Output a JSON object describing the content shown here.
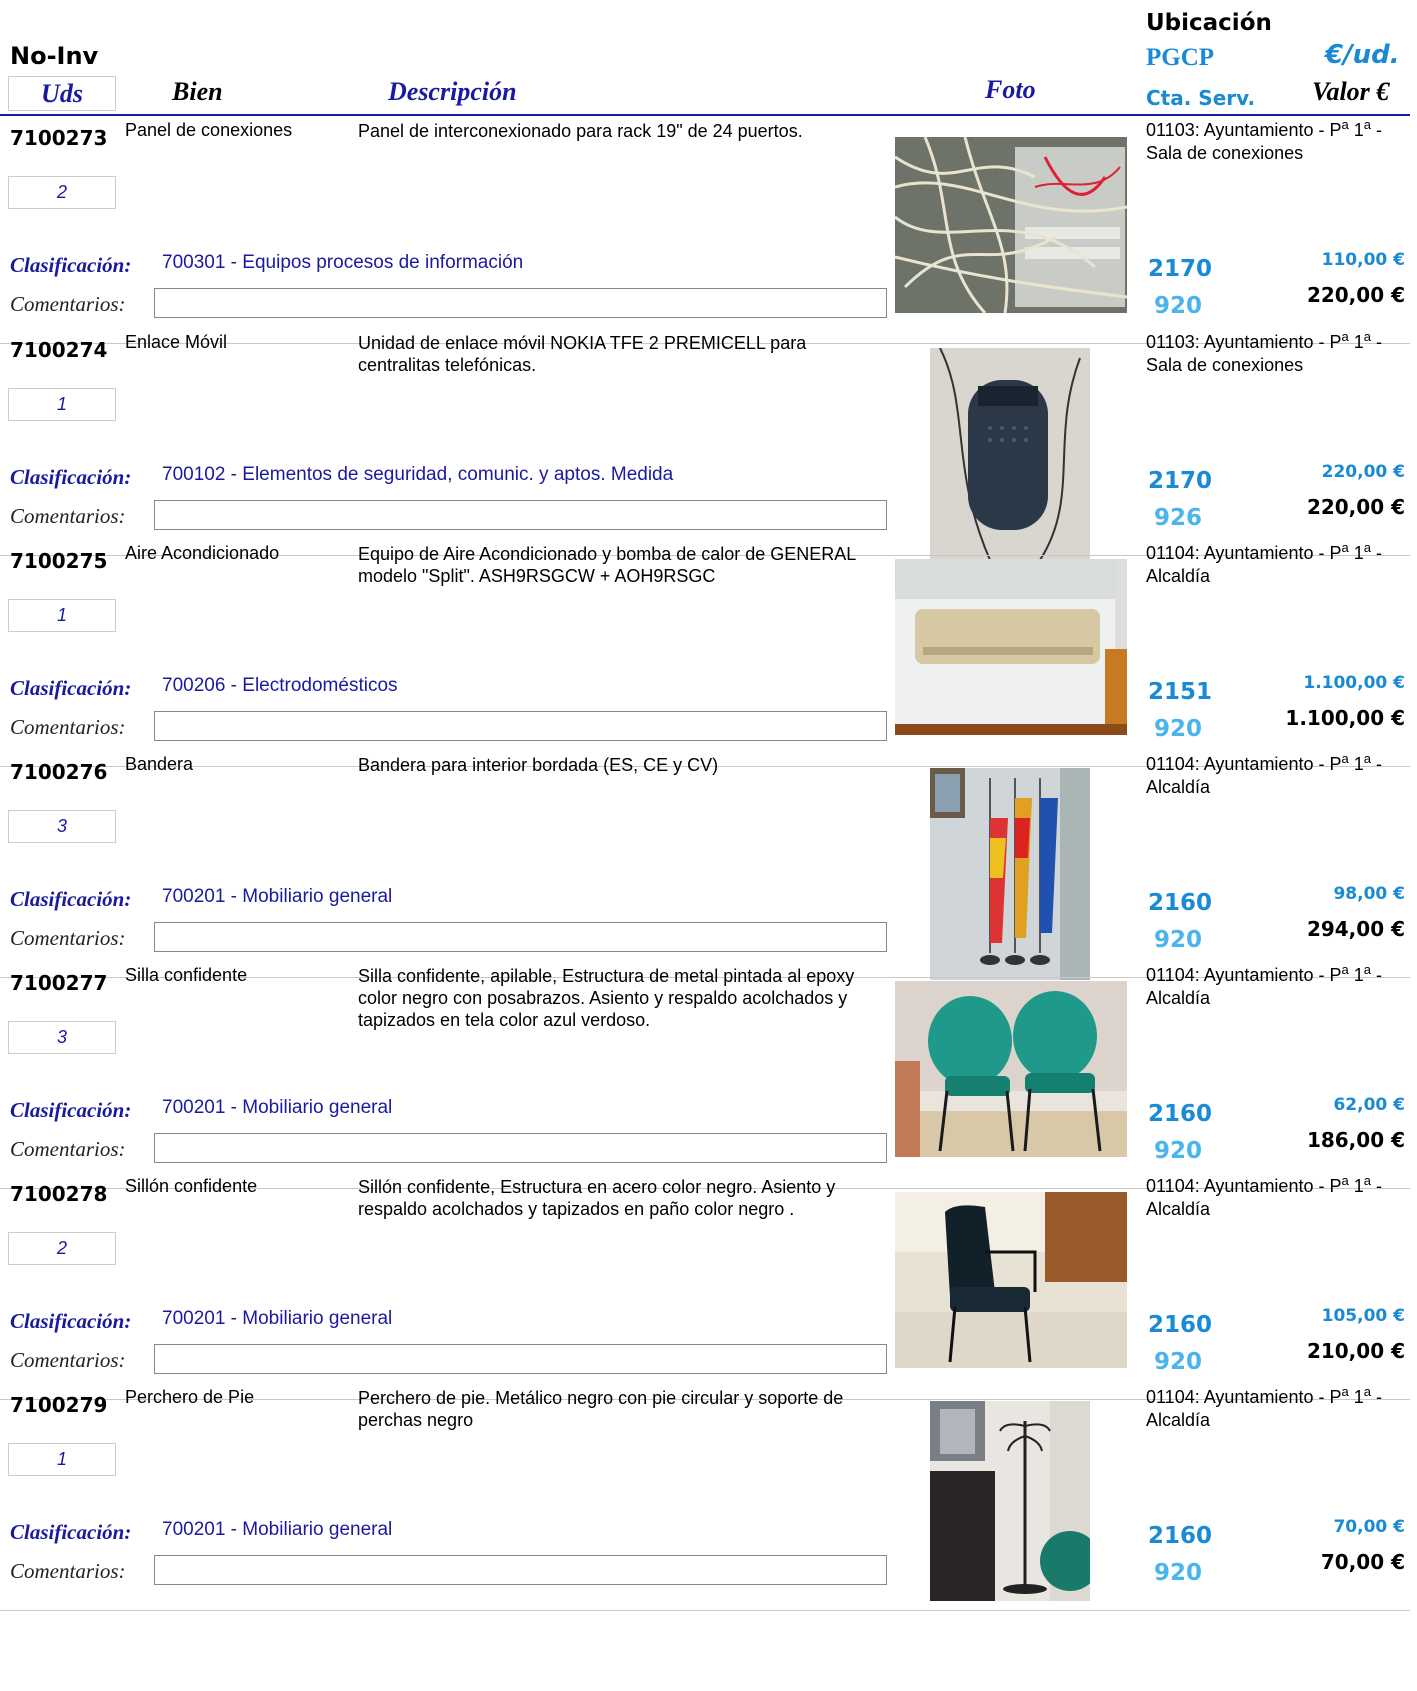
{
  "header": {
    "no_inv": "No-Inv",
    "uds": "Uds",
    "bien": "Bien",
    "descripcion": "Descripción",
    "foto": "Foto",
    "ubicacion": "Ubicación",
    "pgcp": "PGCP",
    "eur_ud": "€/ud.",
    "cta_serv": "Cta. Serv.",
    "valor": "Valor €"
  },
  "labels": {
    "clasificacion": "Clasificación:",
    "comentarios": "Comentarios:"
  },
  "records": [
    {
      "inv": "7100273",
      "qty": "2",
      "name": "Panel de conexiones",
      "description": "Panel de interconexionado para rack 19\" de 24 puertos.",
      "classification": "700301 - Equipos procesos de información",
      "location": "01103: Ayuntamiento - Pª 1ª - Sala de conexiones",
      "account": "2170",
      "service": "920",
      "unit_value": "110,00 €",
      "total_value": "220,00 €",
      "photo": "network patch panel with cables"
    },
    {
      "inv": "7100274",
      "qty": "1",
      "name": "Enlace Móvil",
      "description": "Unidad de enlace móvil NOKIA TFE 2 PREMICELL para centralitas telefónicas.",
      "classification": "700102 - Elementos de seguridad, comunic. y aptos. Medida",
      "location": "01103: Ayuntamiento - Pª 1ª - Sala de conexiones",
      "account": "2170",
      "service": "926",
      "unit_value": "220,00 €",
      "total_value": "220,00 €",
      "photo": "black wall-mounted mobile link unit"
    },
    {
      "inv": "7100275",
      "qty": "1",
      "name": "Aire Acondicionado",
      "description": "Equipo de Aire Acondicionado  y bomba de calor de GENERAL modelo \"Split\". ASH9RSGCW + AOH9RSGC",
      "classification": "700206 - Electrodomésticos",
      "location": "01104: Ayuntamiento - Pª 1ª - Alcaldía",
      "account": "2151",
      "service": "920",
      "unit_value": "1.100,00 €",
      "total_value": "1.100,00 €",
      "photo": "wall split air conditioner unit"
    },
    {
      "inv": "7100276",
      "qty": "3",
      "name": "Bandera",
      "description": "Bandera para interior bordada (ES, CE  y CV)",
      "classification": "700201 - Mobiliario general",
      "location": "01104: Ayuntamiento - Pª 1ª - Alcaldía",
      "account": "2160",
      "service": "920",
      "unit_value": "98,00 €",
      "total_value": "294,00 €",
      "photo": "three indoor flags on stands"
    },
    {
      "inv": "7100277",
      "qty": "3",
      "name": "Silla confidente",
      "description": "Silla confidente, apilable, Estructura de metal pintada al epoxy color negro con posabrazos. Asiento y respaldo acolchados y tapizados en tela color azul verdoso.",
      "classification": "700201 - Mobiliario general",
      "location": "01104: Ayuntamiento - Pª 1ª - Alcaldía",
      "account": "2160",
      "service": "920",
      "unit_value": "62,00 €",
      "total_value": "186,00 €",
      "photo": "two teal upholstered visitor chairs"
    },
    {
      "inv": "7100278",
      "qty": "2",
      "name": "Sillón confidente",
      "description": "Sillón confidente, Estructura en acero color negro. Asiento y respaldo acolchados y tapizados en paño color negro .",
      "classification": "700201 - Mobiliario general",
      "location": "01104: Ayuntamiento - Pª 1ª - Alcaldía",
      "account": "2160",
      "service": "920",
      "unit_value": "105,00 €",
      "total_value": "210,00 €",
      "photo": "black upholstered armchair"
    },
    {
      "inv": "7100279",
      "qty": "1",
      "name": "Perchero de Pie",
      "description": "Perchero de pie. Metálico negro con pie circular y soporte de perchas negro",
      "classification": "700201 - Mobiliario general",
      "location": "01104: Ayuntamiento - Pª 1ª - Alcaldía",
      "account": "2160",
      "service": "920",
      "unit_value": "70,00 €",
      "total_value": "70,00 €",
      "photo": "black standing coat rack"
    }
  ]
}
